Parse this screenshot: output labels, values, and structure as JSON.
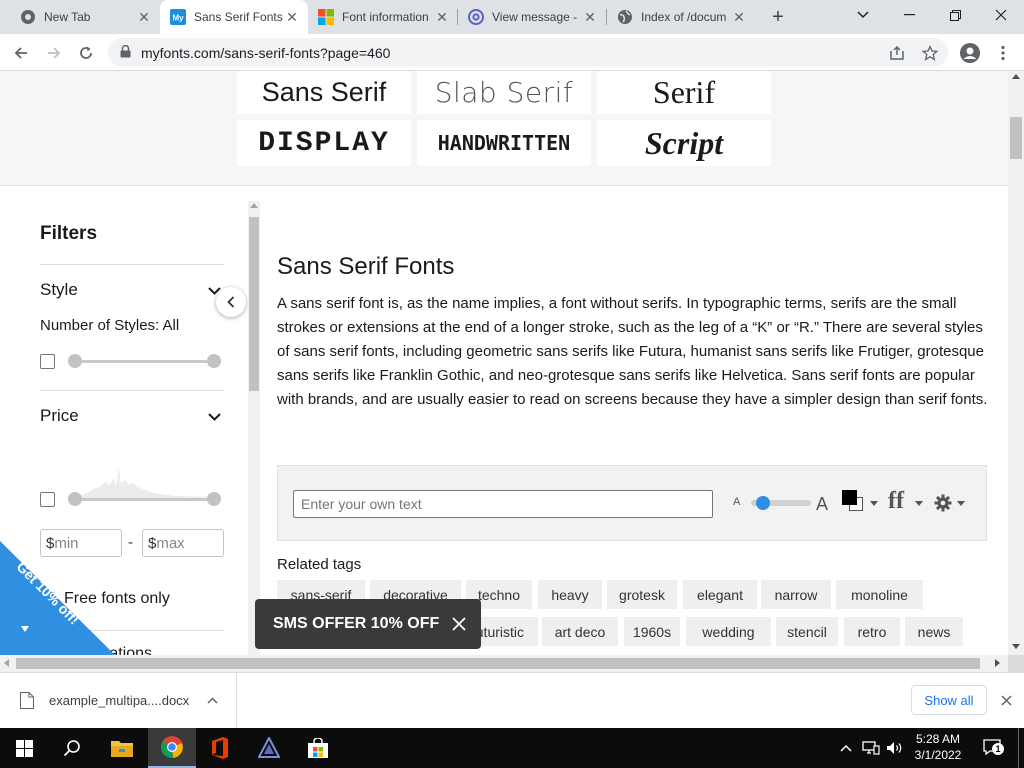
{
  "browser": {
    "tabs": [
      {
        "title": "New Tab",
        "icon": "chrome-icon",
        "active": false
      },
      {
        "title": "Sans Serif Fonts",
        "icon": "myfonts-icon",
        "active": true
      },
      {
        "title": "Font information",
        "icon": "microsoft-icon",
        "active": false
      },
      {
        "title": "View message -",
        "icon": "at-sign-icon",
        "active": false
      },
      {
        "title": "Index of /docum",
        "icon": "globe-icon",
        "active": false
      }
    ],
    "url": "myfonts.com/sans-serif-fonts?page=460"
  },
  "categories": [
    "Sans Serif",
    "Slab Serif",
    "Serif",
    "DISPLAY",
    "HANDWRITTEN",
    "Script"
  ],
  "filters": {
    "title": "Filters",
    "style_label": "Style",
    "num_styles_label": "Number of Styles: All",
    "price_label": "Price",
    "min_placeholder": "min",
    "max_placeholder": "max",
    "currency": "$",
    "range_dash": "-",
    "free_fonts_label": "Free fonts only",
    "next_section_partial": "...ations"
  },
  "promo": {
    "ribbon_text": "Get 10% off!",
    "sms_banner": "SMS OFFER 10% OFF"
  },
  "main": {
    "heading": "Sans Serif Fonts",
    "description": "A sans serif font is, as the name implies, a font without serifs. In typographic terms, serifs are the small strokes or extensions at the end of a longer stroke, such as the leg of a “K” or “R.” There are several styles of sans serif fonts, including geometric sans serifs like Futura, humanist sans serifs like Frutiger, grotesque sans serifs like Franklin Gothic, and neo-grotesque sans serifs like Helvetica. Sans serif fonts are popular with brands, and are usually easier to read on screens because they have a simpler design than serif fonts.",
    "preview_placeholder": "Enter your own text",
    "size_small": "A",
    "size_large": "A",
    "font_size_level": 0.1,
    "related_label": "Related tags",
    "tags_row1": [
      "sans-serif",
      "decorative",
      "techno",
      "heavy",
      "grotesk",
      "elegant",
      "narrow",
      "monoline"
    ],
    "tags_row2": [
      "futuristic",
      "art deco",
      "1960s",
      "wedding",
      "stencil",
      "retro",
      "news"
    ]
  },
  "downloads": {
    "file_name": "example_multipa....docx",
    "show_all": "Show all"
  },
  "taskbar": {
    "time": "5:28 AM",
    "date": "3/1/2022",
    "notification_count": "1"
  },
  "colors": {
    "accent_blue": "#1a73e8",
    "promo_blue": "#2f8fe0",
    "banner_dark": "#3a3a3a"
  }
}
